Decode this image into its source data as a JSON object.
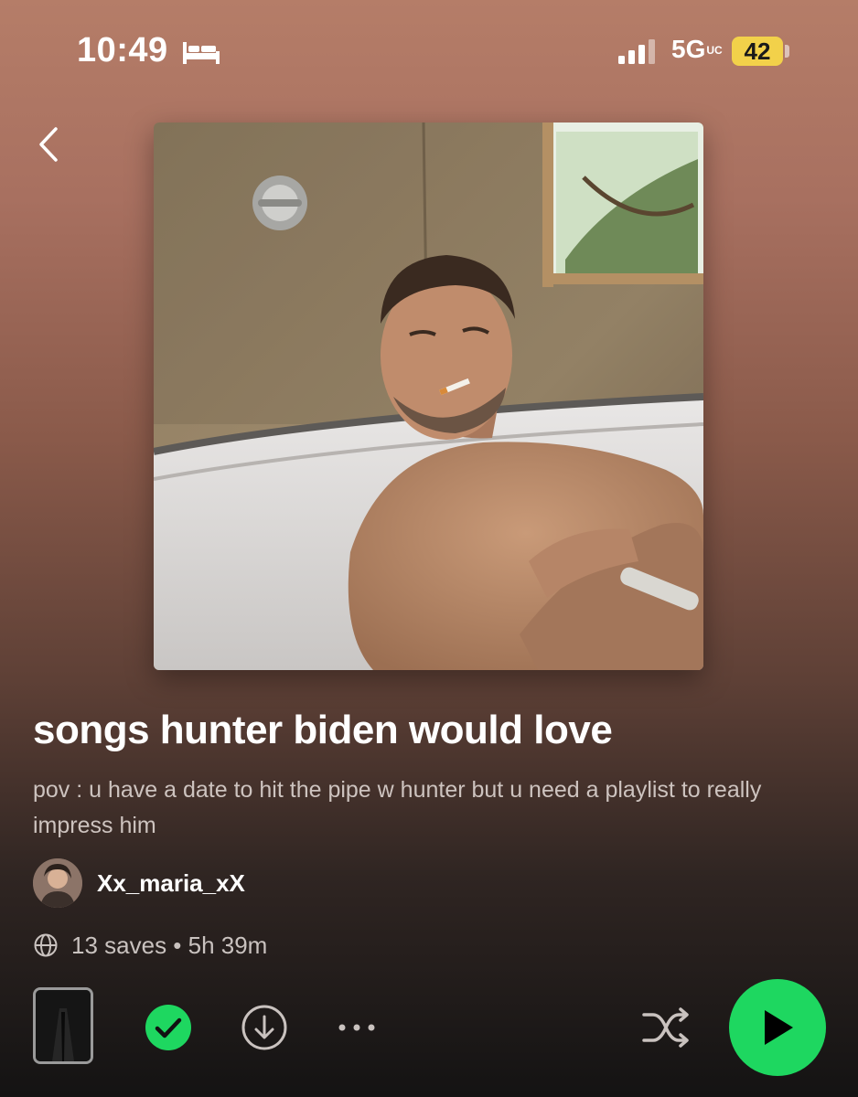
{
  "status_bar": {
    "time": "10:49",
    "network": "5G",
    "network_suffix": "UC",
    "battery": "42",
    "icons": [
      "bed-icon",
      "signal-icon"
    ],
    "battery_color": "#f2d14a"
  },
  "navigation": {
    "back_icon": "chevron-left-icon"
  },
  "playlist": {
    "title": "songs hunter biden would love",
    "description": "pov : u have a date to hit the pipe w hunter but u need a playlist to really impress him",
    "owner": "Xx_maria_xX",
    "meta": "13 saves • 5h 39m"
  },
  "actions": {
    "icons": [
      "check-circle-icon",
      "download-icon",
      "more-icon",
      "shuffle-icon",
      "play-icon"
    ],
    "accent_color": "#1ed760"
  }
}
